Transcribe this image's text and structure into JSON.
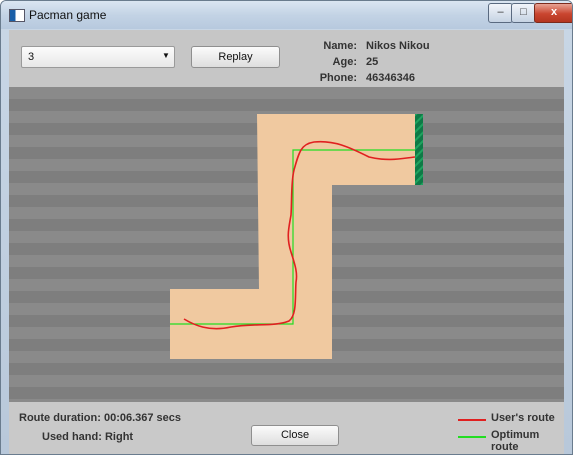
{
  "window": {
    "title": "Pacman game",
    "controls": {
      "minimize": "–",
      "maximize": "□",
      "close": "x"
    }
  },
  "toolbar": {
    "level_select": {
      "value": "3"
    },
    "replay_label": "Replay"
  },
  "player": {
    "name_label": "Name:",
    "name": "Nikos Nikou",
    "age_label": "Age:",
    "age": "25",
    "phone_label": "Phone:",
    "phone": "46346346"
  },
  "status": {
    "duration_label": "Route duration:",
    "duration": "00:06.367 secs",
    "hand_label": "Used hand:",
    "hand": "Right",
    "close_label": "Close"
  },
  "legend": {
    "user_route": {
      "label": "User's route",
      "color": "#e02020"
    },
    "optimum_route": {
      "label": "Optimum route",
      "color": "#22dd22"
    }
  },
  "colors": {
    "path": "#f0c9a0",
    "goal": "#0e7a46",
    "background": "#848484"
  }
}
